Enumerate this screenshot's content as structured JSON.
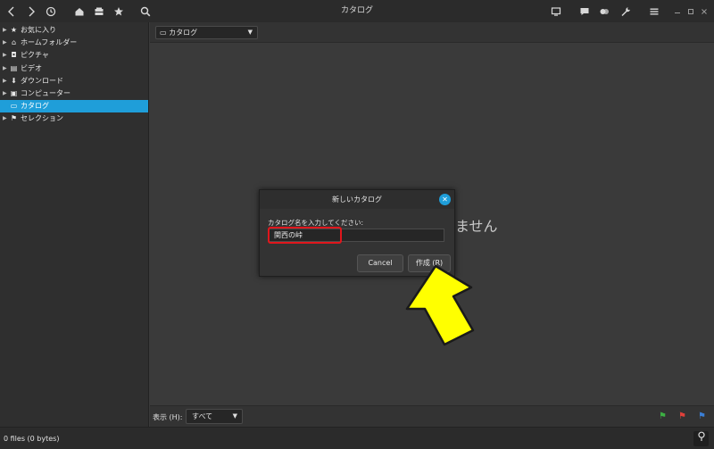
{
  "titlebar": {
    "title": "カタログ",
    "icons": [
      "chevron-left-icon",
      "chevron-right-icon",
      "history-icon",
      "home-icon",
      "catalog-icon",
      "star-icon",
      "search-icon",
      "monitor-icon",
      "chat-icon",
      "tags-icon",
      "wrench-icon",
      "menu-icon",
      "minimize-icon",
      "maximize-icon",
      "close-icon"
    ]
  },
  "sidebar": {
    "items": [
      {
        "label": "お気に入り",
        "icon": "star-icon",
        "expandable": true,
        "selected": false
      },
      {
        "label": "ホームフォルダー",
        "icon": "home-icon",
        "expandable": true,
        "selected": false
      },
      {
        "label": "ピクチャ",
        "icon": "camera-icon",
        "expandable": true,
        "selected": false
      },
      {
        "label": "ビデオ",
        "icon": "film-icon",
        "expandable": true,
        "selected": false
      },
      {
        "label": "ダウンロード",
        "icon": "download-icon",
        "expandable": true,
        "selected": false
      },
      {
        "label": "コンピューター",
        "icon": "computer-icon",
        "expandable": true,
        "selected": false
      },
      {
        "label": "カタログ",
        "icon": "catalog-icon",
        "expandable": false,
        "selected": true
      },
      {
        "label": "セレクション",
        "icon": "flag-icon",
        "expandable": true,
        "selected": false
      }
    ]
  },
  "main": {
    "catalog_combo": "カタログ",
    "empty_message": "ません"
  },
  "bottombar": {
    "show_label": "表示 (H):",
    "show_value": "すべて",
    "flag_colors": [
      "#3cb043",
      "#e0403a",
      "#3b7fd6"
    ]
  },
  "status": {
    "text": "0 files (0 bytes)"
  },
  "dialog": {
    "title": "新しいカタログ",
    "prompt": "カタログ名を入力してください:",
    "input_value": "関西の峠",
    "cancel_label": "Cancel",
    "create_label": "作成 (R)"
  },
  "colors": {
    "accent": "#1f9ed9",
    "highlight": "#e0161c",
    "arrow": "#ffff00"
  }
}
